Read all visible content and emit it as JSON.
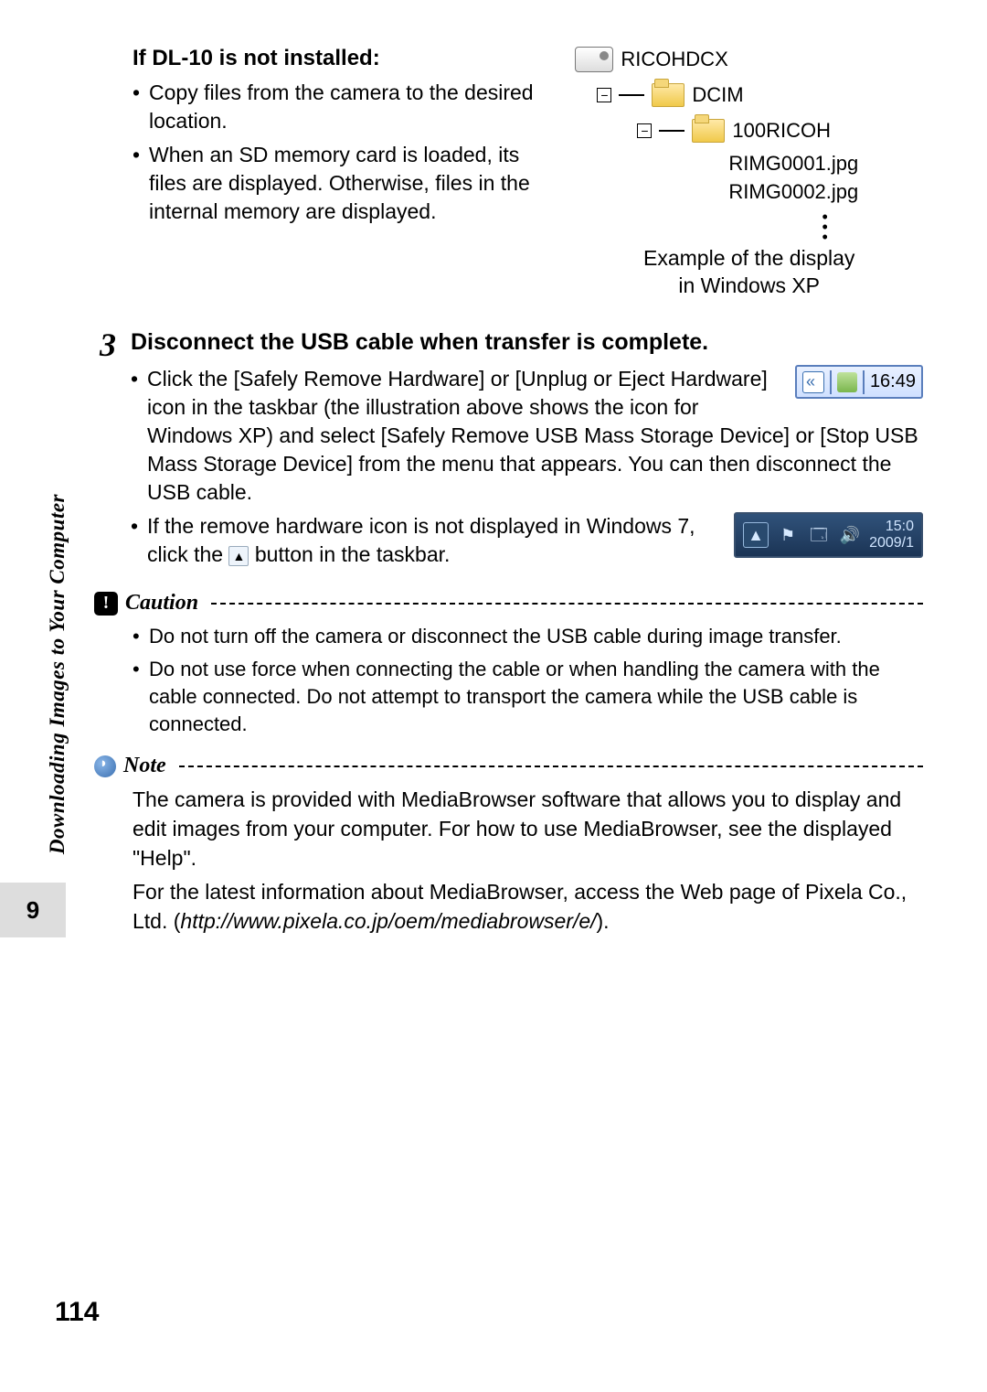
{
  "sidebar": {
    "section_title": "Downloading Images to Your Computer",
    "chapter_number": "9"
  },
  "page_number": "114",
  "dl10": {
    "heading": "If DL-10 is not installed:",
    "bullets": [
      "Copy files from the camera to the desired location.",
      "When an SD memory card is loaded, its files are displayed. Otherwise, files in the internal memory are displayed."
    ]
  },
  "tree": {
    "root": "RICOHDCX",
    "folder1": "DCIM",
    "folder2": "100RICOH",
    "files": [
      "RIMG0001.jpg",
      "RIMG0002.jpg"
    ],
    "caption_l1": "Example of the display",
    "caption_l2": "in Windows XP"
  },
  "step3": {
    "number": "3",
    "title": "Disconnect the USB cable when transfer is complete.",
    "bullet1": "Click the [Safely Remove Hardware] or [Unplug or Eject Hardware] icon in the taskbar (the illustration above shows the icon for Windows XP) and select [Safely Remove USB Mass Storage Device] or [Stop USB Mass Storage Device] from the menu that appears. You can then disconnect the USB cable.",
    "bullet2_pre": "If the remove hardware icon is not displayed in Windows 7, click the ",
    "bullet2_post": " button in the taskbar.",
    "xp_time": "16:49",
    "w7_time": "15:0",
    "w7_date": "2009/1"
  },
  "caution": {
    "label": "Caution",
    "items": [
      "Do not turn off the camera or disconnect the USB cable during image transfer.",
      "Do not use force when connecting the cable or when handling the camera with the cable connected. Do not attempt to transport the camera while the USB cable is connected."
    ]
  },
  "note": {
    "label": "Note",
    "p1": "The camera is provided with MediaBrowser software that allows you to display and edit images from your computer. For how to use MediaBrowser, see the displayed \"Help\".",
    "p2_pre": "For the latest information about MediaBrowser, access the Web page of Pixela Co., Ltd. (",
    "p2_url": "http://www.pixela.co.jp/oem/mediabrowser/e/",
    "p2_post": ")."
  }
}
